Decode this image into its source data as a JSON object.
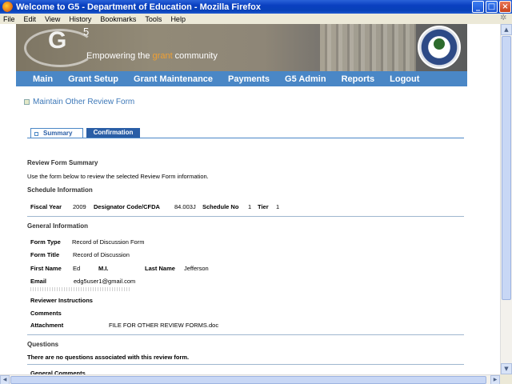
{
  "window": {
    "title": "Welcome to G5 - Department of Education - Mozilla Firefox"
  },
  "menubar": {
    "items": [
      "File",
      "Edit",
      "View",
      "History",
      "Bookmarks",
      "Tools",
      "Help"
    ]
  },
  "banner": {
    "logo": "G",
    "logo_sup": "5",
    "tagline_pre": "Empowering the ",
    "tagline_grant": "grant",
    "tagline_post": " community"
  },
  "nav": {
    "items": [
      "Main",
      "Grant Setup",
      "Grant Maintenance",
      "Payments",
      "G5 Admin",
      "Reports",
      "Logout"
    ]
  },
  "page": {
    "title": "Maintain Other Review Form"
  },
  "tabs": {
    "summary": "Summary",
    "confirmation": "Confirmation"
  },
  "summary": {
    "heading": "Review Form Summary",
    "intro": "Use the form below to review the selected Review Form information."
  },
  "schedule": {
    "heading": "Schedule Information",
    "fiscal_year_label": "Fiscal Year",
    "fiscal_year": "2009",
    "designator_label": "Designator Code/CFDA",
    "designator": "84.003J",
    "schedule_no_label": "Schedule No",
    "schedule_no": "1",
    "tier_label": "Tier",
    "tier": "1"
  },
  "general": {
    "heading": "General Information",
    "form_type_label": "Form Type",
    "form_type": "Record of Discussion Form",
    "form_title_label": "Form Title",
    "form_title": "Record of Discussion",
    "first_name_label": "First Name",
    "first_name": "Ed",
    "mi_label": "M.I.",
    "last_name_label": "Last Name",
    "last_name": "Jefferson",
    "email_label": "Email",
    "email": "edg5user1@gmail.com",
    "reviewer_instructions_label": "Reviewer Instructions",
    "comments_label": "Comments",
    "attachment_label": "Attachment",
    "attachment": "FILE FOR OTHER REVIEW FORMS.doc"
  },
  "questions": {
    "heading": "Questions",
    "message": "There are no questions associated with this review form."
  },
  "general_comments": {
    "label": "General Comments"
  }
}
